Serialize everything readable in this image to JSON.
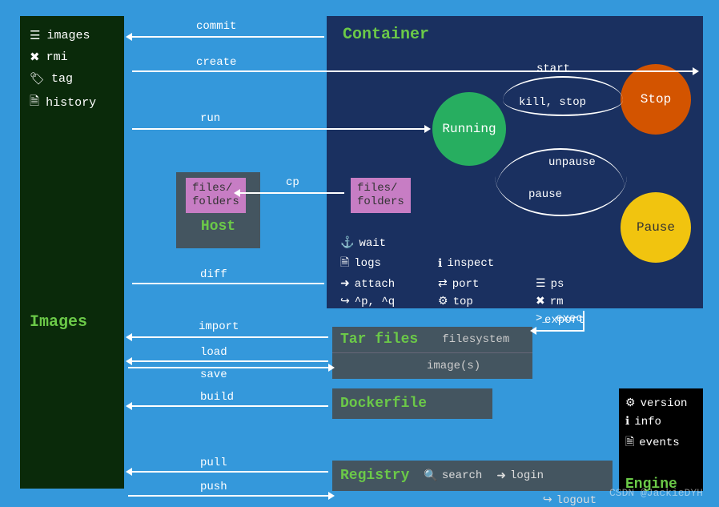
{
  "images_panel": {
    "title": "Images",
    "items": [
      {
        "icon": "list-icon",
        "label": "images"
      },
      {
        "icon": "x-icon",
        "label": "rmi"
      },
      {
        "icon": "tag-icon",
        "label": "tag"
      },
      {
        "icon": "doc-icon",
        "label": "history"
      }
    ]
  },
  "container_panel": {
    "title": "Container",
    "states": {
      "running": "Running",
      "stop": "Stop",
      "pause": "Pause"
    },
    "transitions": {
      "start": "start",
      "kill_stop": "kill, stop",
      "pause": "pause",
      "unpause": "unpause"
    },
    "files_label": "files/\nfolders",
    "commands": [
      {
        "icon": "anchor-icon",
        "label": "wait"
      },
      {
        "icon": "doc-icon",
        "label": "logs"
      },
      {
        "icon": "info-icon",
        "label": "inspect"
      },
      {
        "icon": "login-icon",
        "label": "attach"
      },
      {
        "icon": "swap-icon",
        "label": "port"
      },
      {
        "icon": "list-icon",
        "label": "ps"
      },
      {
        "icon": "logout-icon",
        "label": "^p, ^q"
      },
      {
        "icon": "gears-icon",
        "label": "top"
      },
      {
        "icon": "x-icon",
        "label": "rm"
      },
      {
        "icon": "terminal-icon",
        "label": ">_ exec"
      }
    ]
  },
  "host": {
    "title": "Host",
    "files_label": "files/\nfolders"
  },
  "tarfiles": {
    "title": "Tar files",
    "rows": [
      "filesystem",
      "image(s)"
    ]
  },
  "dockerfile": {
    "title": "Dockerfile"
  },
  "registry": {
    "title": "Registry",
    "commands": [
      {
        "icon": "search-icon",
        "label": "search"
      },
      {
        "icon": "login-icon",
        "label": "login"
      },
      {
        "icon": "logout-icon",
        "label": "logout"
      }
    ]
  },
  "engine": {
    "title": "Engine",
    "items": [
      {
        "icon": "gear-icon",
        "label": "version"
      },
      {
        "icon": "info-icon",
        "label": "info"
      },
      {
        "icon": "doc-icon",
        "label": "events"
      }
    ]
  },
  "arrows": {
    "commit": "commit",
    "create": "create",
    "run": "run",
    "cp": "cp",
    "diff": "diff",
    "import": "import",
    "export": "export",
    "load": "load",
    "save": "save",
    "build": "build",
    "pull": "pull",
    "push": "push"
  },
  "watermark": "CSDN @JackieDYH"
}
